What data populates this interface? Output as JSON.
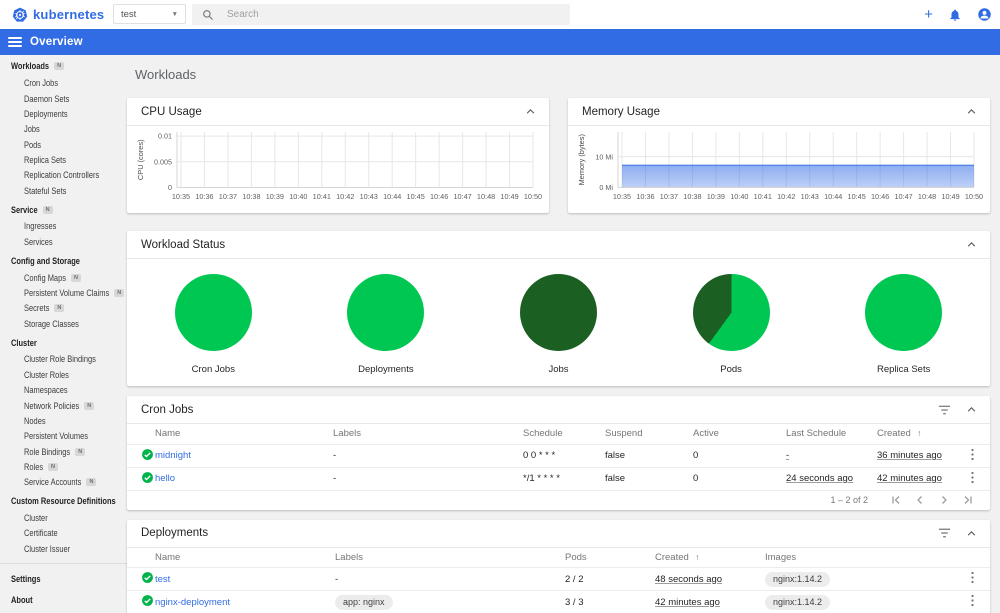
{
  "header": {
    "brand": "kubernetes",
    "namespace_value": "test",
    "search_placeholder": "Search"
  },
  "toolbar": {
    "title": "Overview"
  },
  "sidebar": {
    "badge_letter": "N",
    "sections": [
      {
        "label": "Workloads",
        "badge": true,
        "items": [
          {
            "label": "Cron Jobs"
          },
          {
            "label": "Daemon Sets"
          },
          {
            "label": "Deployments"
          },
          {
            "label": "Jobs"
          },
          {
            "label": "Pods"
          },
          {
            "label": "Replica Sets"
          },
          {
            "label": "Replication Controllers"
          },
          {
            "label": "Stateful Sets"
          }
        ]
      },
      {
        "label": "Service",
        "badge": true,
        "items": [
          {
            "label": "Ingresses"
          },
          {
            "label": "Services"
          }
        ]
      },
      {
        "label": "Config and Storage",
        "badge": false,
        "items": [
          {
            "label": "Config Maps",
            "badge": true
          },
          {
            "label": "Persistent Volume Claims",
            "badge": true
          },
          {
            "label": "Secrets",
            "badge": true
          },
          {
            "label": "Storage Classes"
          }
        ]
      },
      {
        "label": "Cluster",
        "badge": false,
        "items": [
          {
            "label": "Cluster Role Bindings"
          },
          {
            "label": "Cluster Roles"
          },
          {
            "label": "Namespaces"
          },
          {
            "label": "Network Policies",
            "badge": true
          },
          {
            "label": "Nodes"
          },
          {
            "label": "Persistent Volumes"
          },
          {
            "label": "Role Bindings",
            "badge": true
          },
          {
            "label": "Roles",
            "badge": true
          },
          {
            "label": "Service Accounts",
            "badge": true
          }
        ]
      },
      {
        "label": "Custom Resource Definitions",
        "badge": false,
        "items": [
          {
            "label": "Cluster"
          },
          {
            "label": "Certificate"
          },
          {
            "label": "Cluster Issuer"
          }
        ]
      }
    ],
    "footer_sections": [
      {
        "label": "Settings"
      },
      {
        "label": "About"
      }
    ]
  },
  "main": {
    "title": "Workloads"
  },
  "colors": {
    "brand_blue": "#326ce5",
    "success_green": "#00c752",
    "dark_green": "#1c5f23"
  },
  "chart_data": [
    {
      "type": "line",
      "title": "CPU Usage",
      "ylabel": "CPU (cores)",
      "x": [
        "10:35",
        "10:36",
        "10:37",
        "10:38",
        "10:39",
        "10:40",
        "10:41",
        "10:42",
        "10:43",
        "10:44",
        "10:45",
        "10:46",
        "10:47",
        "10:48",
        "10:49",
        "10:50"
      ],
      "yticks": [
        [
          0,
          "0"
        ],
        [
          0.005,
          "0.005"
        ],
        [
          0.01,
          "0.01"
        ]
      ],
      "ylim": [
        0,
        0.0108
      ],
      "series": []
    },
    {
      "type": "area",
      "title": "Memory Usage",
      "ylabel": "Memory (bytes)",
      "x": [
        "10:35",
        "10:36",
        "10:37",
        "10:38",
        "10:39",
        "10:40",
        "10:41",
        "10:42",
        "10:43",
        "10:44",
        "10:45",
        "10:46",
        "10:47",
        "10:48",
        "10:49",
        "10:50"
      ],
      "yticks": [
        [
          0,
          "0 Mi"
        ],
        [
          10,
          "10 Mi"
        ]
      ],
      "ylim": [
        0,
        18
      ],
      "series": [
        {
          "name": "Memory",
          "values": [
            7.2,
            7.2,
            7.2,
            7.2,
            7.2,
            7.2,
            7.2,
            7.2,
            7.2,
            7.2,
            7.2,
            7.2,
            7.2,
            7.2,
            7.2,
            7.2
          ]
        }
      ]
    },
    {
      "type": "pie",
      "title": "Workload Status",
      "pies": [
        {
          "label": "Cron Jobs",
          "slices": [
            {
              "percent": 100,
              "color": "#00c752"
            }
          ]
        },
        {
          "label": "Deployments",
          "slices": [
            {
              "percent": 100,
              "color": "#00c752"
            }
          ]
        },
        {
          "label": "Jobs",
          "slices": [
            {
              "percent": 100,
              "color": "#1c5f23"
            }
          ]
        },
        {
          "label": "Pods",
          "slices": [
            {
              "percent": 60,
              "color": "#00c752"
            },
            {
              "percent": 40,
              "color": "#1c5f23"
            }
          ]
        },
        {
          "label": "Replica Sets",
          "slices": [
            {
              "percent": 100,
              "color": "#00c752"
            }
          ]
        }
      ]
    }
  ],
  "cron_jobs": {
    "title": "Cron Jobs",
    "columns": [
      "Name",
      "Labels",
      "Schedule",
      "Suspend",
      "Active",
      "Last Schedule",
      "Created"
    ],
    "sort_column": "Created",
    "rows": [
      {
        "name": "midnight",
        "labels": "-",
        "schedule": "0 0 * * *",
        "suspend": "false",
        "active": "0",
        "last_schedule": "-",
        "created": "36 minutes ago"
      },
      {
        "name": "hello",
        "labels": "-",
        "schedule": "*/1 * * * *",
        "suspend": "false",
        "active": "0",
        "last_schedule": "24 seconds ago",
        "created": "42 minutes ago"
      }
    ],
    "pagination": "1 – 2 of 2"
  },
  "deployments": {
    "title": "Deployments",
    "columns": [
      "Name",
      "Labels",
      "Pods",
      "Created",
      "Images"
    ],
    "sort_column": "Created",
    "rows": [
      {
        "name": "test",
        "labels": "-",
        "pods": "2 / 2",
        "created": "48 seconds ago",
        "images": "nginx:1.14.2"
      },
      {
        "name": "nginx-deployment",
        "labels": "app: nginx",
        "pods": "3 / 3",
        "created": "42 minutes ago",
        "images": "nginx:1.14.2"
      }
    ]
  }
}
